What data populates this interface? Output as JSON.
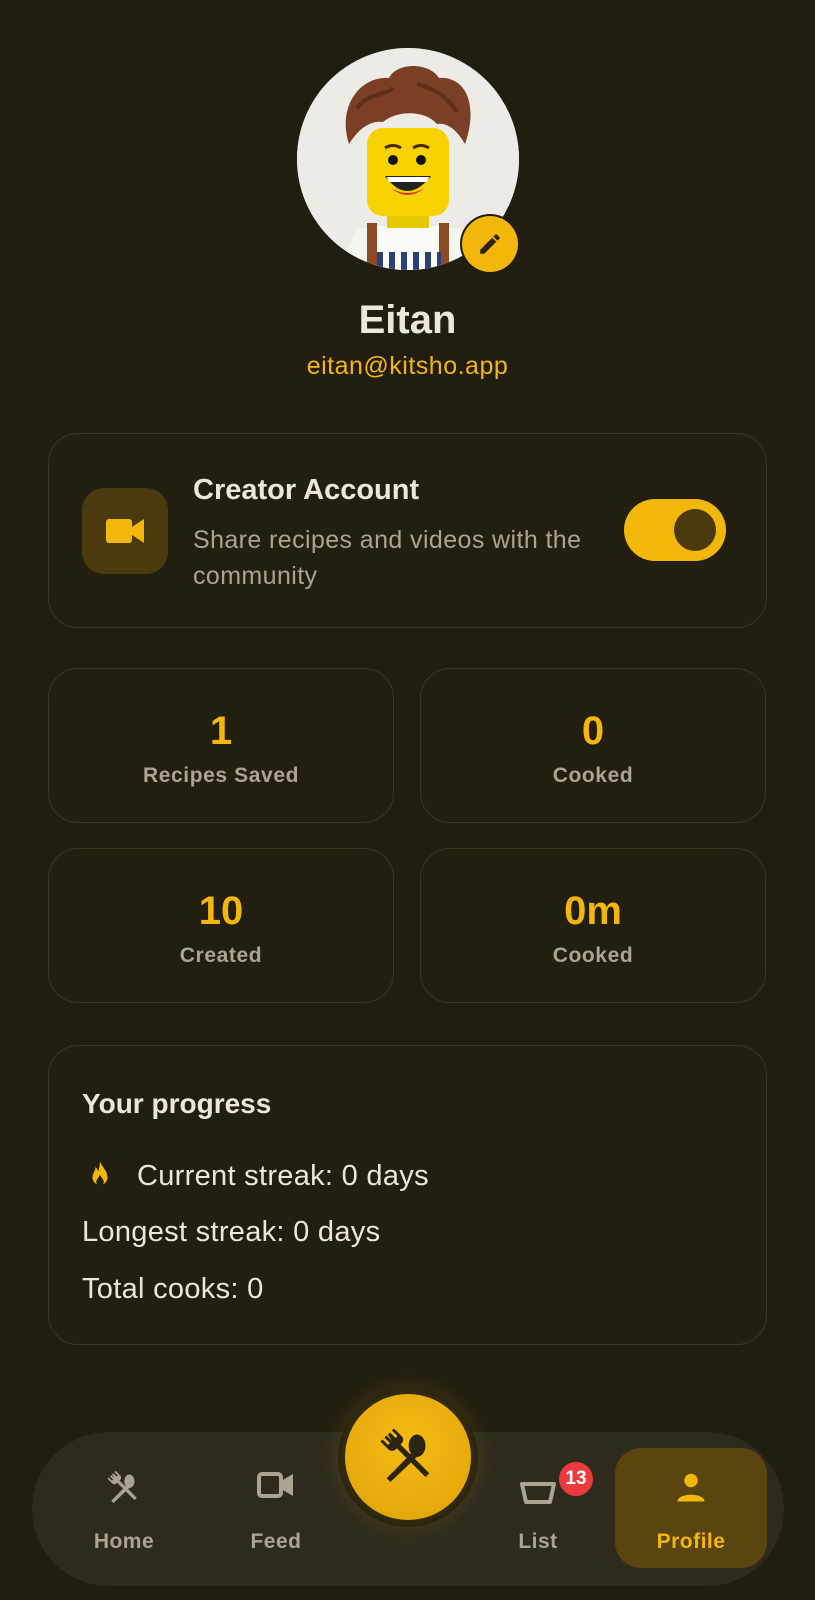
{
  "profile": {
    "name": "Eitan",
    "email": "eitan@kitsho.app",
    "avatar_icon": "avatar-image",
    "edit_icon": "pencil-icon"
  },
  "creator": {
    "title": "Creator Account",
    "description": "Share recipes and videos with the community",
    "icon": "video-camera-icon",
    "enabled": true
  },
  "stats": [
    {
      "value": "1",
      "label": "Recipes Saved"
    },
    {
      "value": "0",
      "label": "Cooked"
    },
    {
      "value": "10",
      "label": "Created"
    },
    {
      "value": "0m",
      "label": "Cooked"
    }
  ],
  "progress": {
    "title": "Your progress",
    "current_streak": "Current streak: 0 days",
    "longest_streak": "Longest streak: 0 days",
    "total_cooks": "Total cooks: 0"
  },
  "nav": {
    "home": "Home",
    "feed": "Feed",
    "list": "List",
    "list_badge": "13",
    "profile": "Profile"
  },
  "colors": {
    "background": "#211e11",
    "accent": "#f3b70c",
    "badge": "#ea3a3d"
  }
}
